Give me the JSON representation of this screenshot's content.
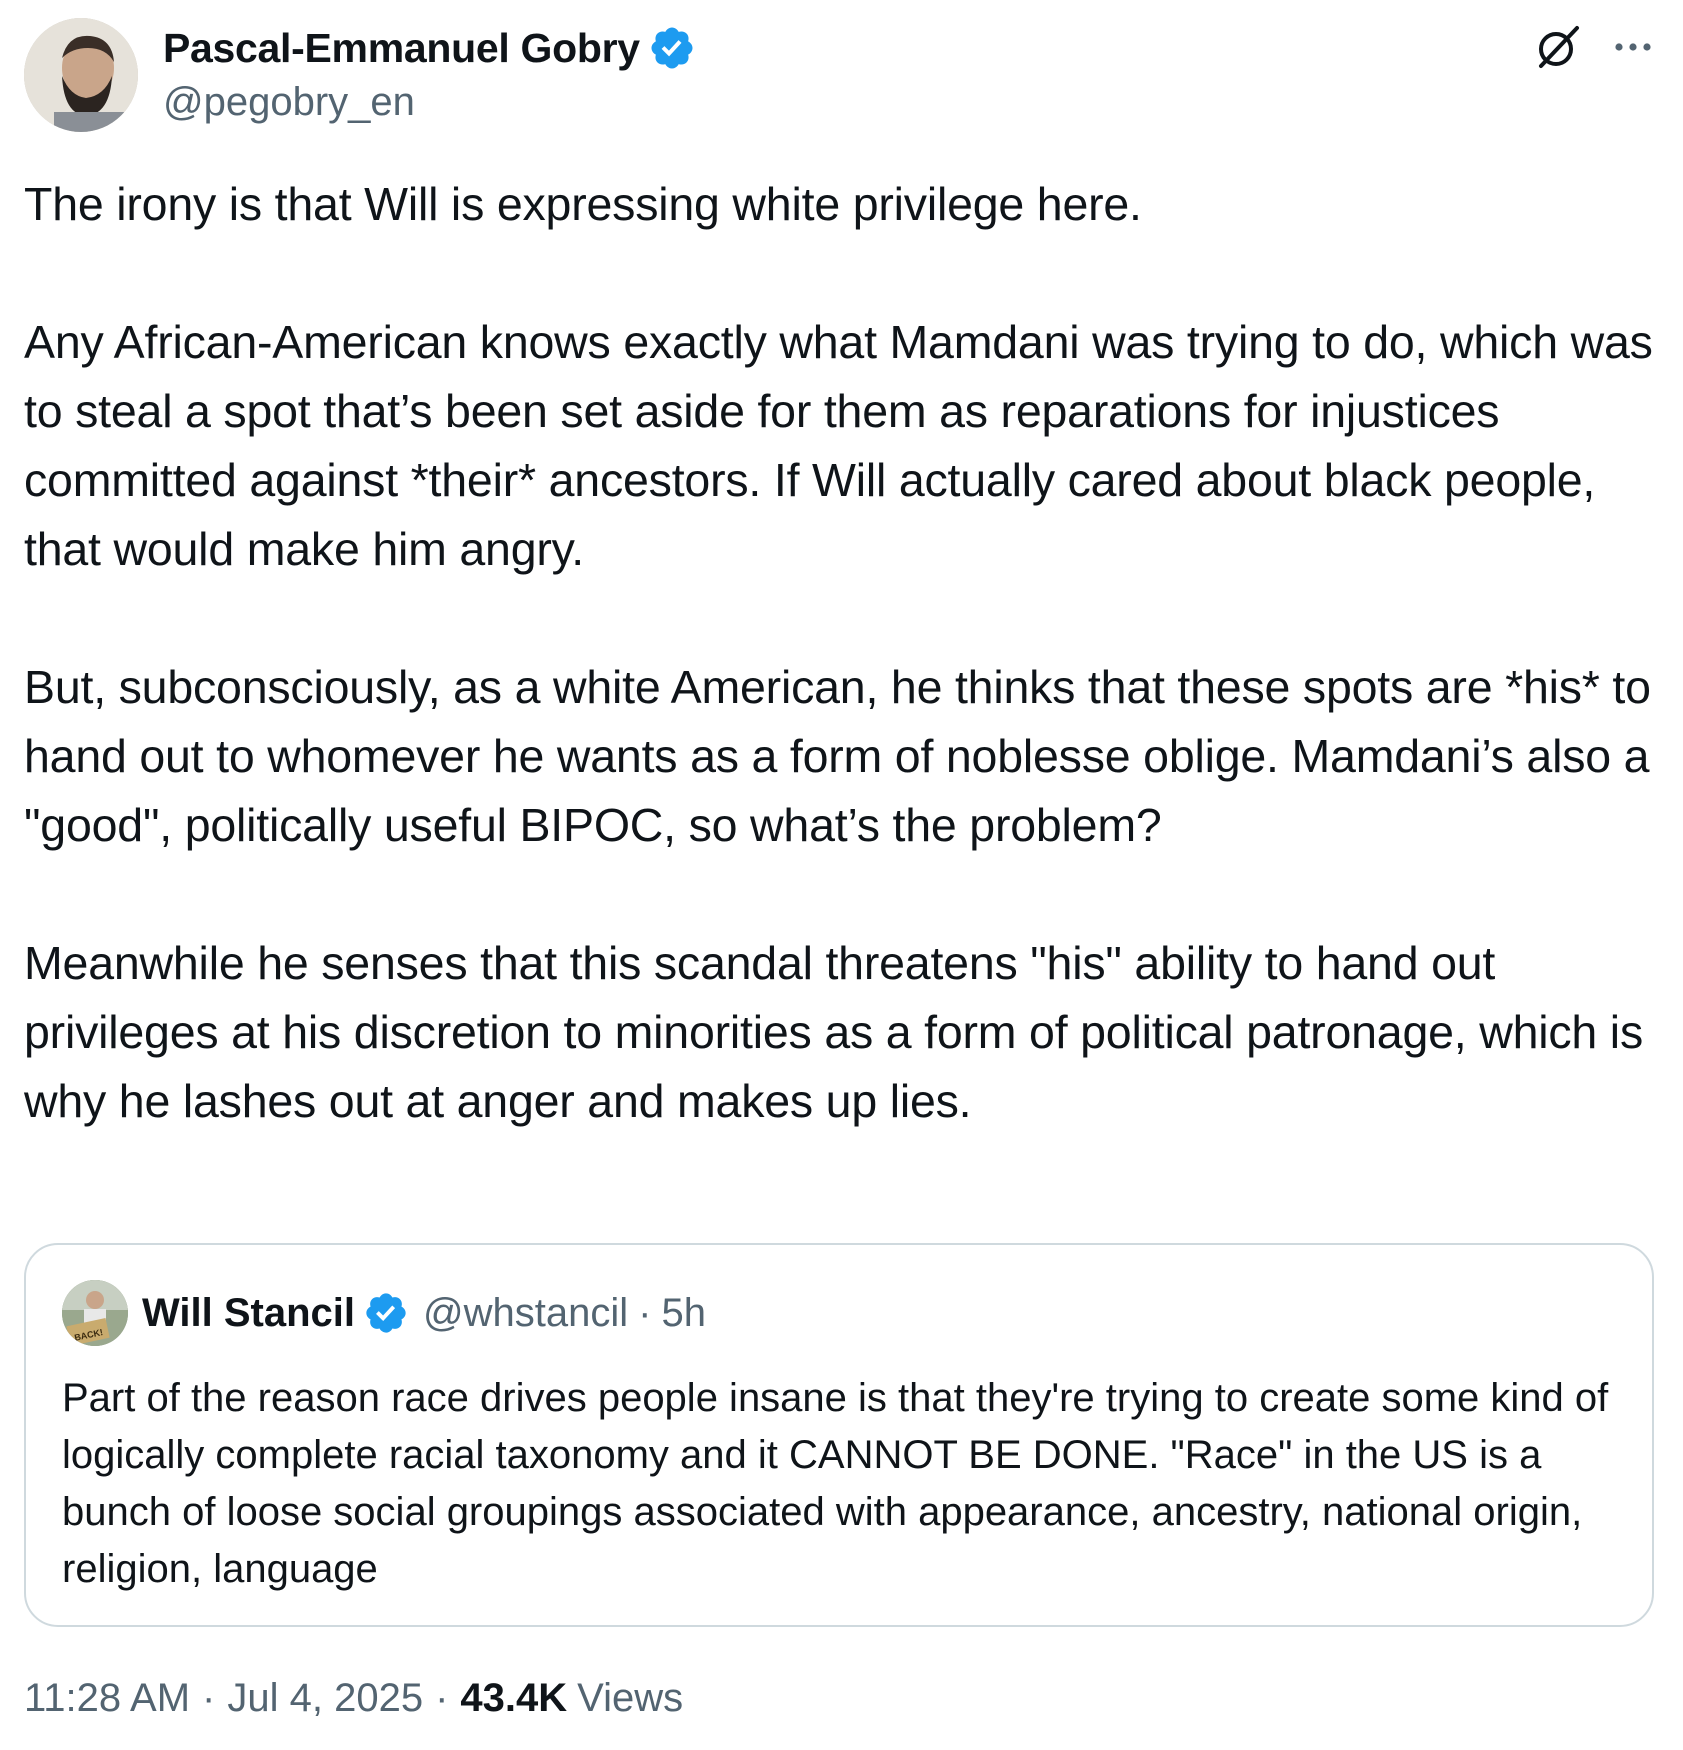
{
  "author": {
    "display_name": "Pascal-Emmanuel Gobry",
    "handle": "@pegobry_en",
    "verified": true
  },
  "icons": {
    "grok": "grok-icon",
    "more": "more-icon",
    "verified": "verified-badge-icon"
  },
  "body": "The irony is that Will is expressing white privilege here.\n\nAny African-American knows exactly what Mamdani was trying to do, which was to steal a spot that’s been set aside for them as reparations for injustices committed against *their* ancestors. If Will actually cared about black people, that would make him angry.\n\nBut, subconsciously, as a white American, he thinks that these spots are *his* to hand out to whomever he wants as a form of noblesse oblige. Mamdani’s also a \"good\", politically useful BIPOC, so what’s the problem?\n\nMeanwhile he senses that this scandal threatens \"his\" ability to hand out privileges at his discretion to minorities as a form of political patronage, which is why he lashes out at anger and makes up lies.",
  "quote": {
    "display_name": "Will Stancil",
    "handle": "@whstancil",
    "dot": "·",
    "time": "5h",
    "verified": true,
    "avatar_sign_text": "BACK!",
    "text": "Part of the reason race drives people insane is that they're trying to create some kind of logically complete racial taxonomy and it CANNOT BE DONE. \"Race\" in the US is a bunch of loose social groupings associated with appearance, ancestry, national origin, religion, language"
  },
  "footer": {
    "time": "11:28 AM",
    "sep1": "·",
    "date": "Jul 4, 2025",
    "sep2": "·",
    "views_count": "43.4K",
    "views_label": "Views"
  },
  "colors": {
    "verified_blue": "#1d9bf0",
    "secondary_text": "#536471",
    "border": "#cfd9de",
    "primary_text": "#0f1419"
  }
}
